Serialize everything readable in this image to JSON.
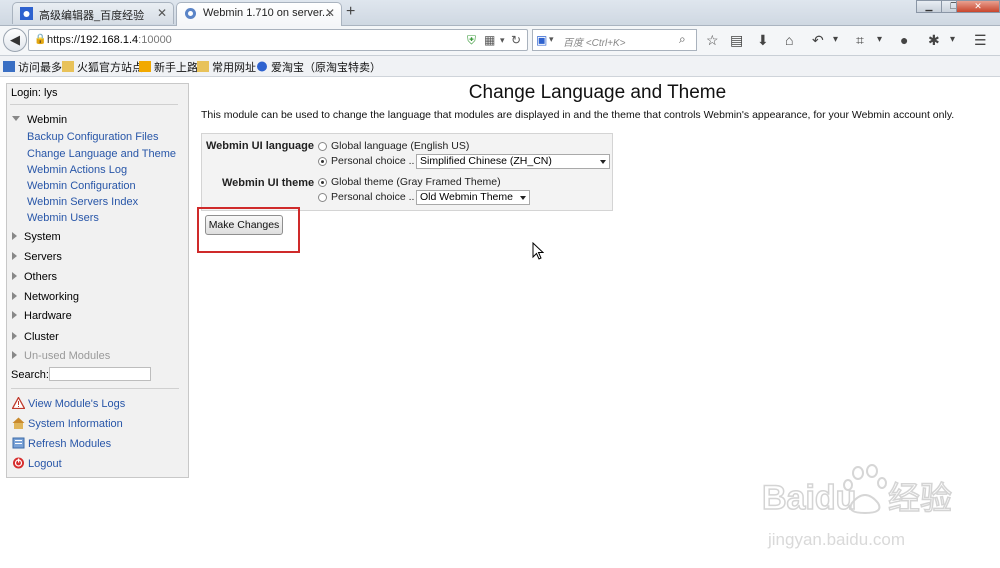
{
  "browser": {
    "tabs": [
      {
        "label": "高级编辑器_百度经验",
        "active": false
      },
      {
        "label": "Webmin 1.710 on server...",
        "active": true
      }
    ],
    "url": {
      "scheme": "https://",
      "host": "192.168.1.4",
      "port": ":10000"
    },
    "search_placeholder": "百度 <Ctrl+K>",
    "bookmarks": [
      "访问最多",
      "火狐官方站点",
      "新手上路",
      "常用网址",
      "爱淘宝（原淘宝特卖）"
    ]
  },
  "sidebar": {
    "login": "Login: lys",
    "webmin_label": "Webmin",
    "webmin_items": [
      "Backup Configuration Files",
      "Change Language and Theme",
      "Webmin Actions Log",
      "Webmin Configuration",
      "Webmin Servers Index",
      "Webmin Users"
    ],
    "categories": [
      "System",
      "Servers",
      "Others",
      "Networking",
      "Hardware",
      "Cluster",
      "Un-used Modules"
    ],
    "search_label": "Search:",
    "actions": [
      "View Module's Logs",
      "System Information",
      "Refresh Modules",
      "Logout"
    ]
  },
  "main": {
    "title": "Change Language and Theme",
    "description": "This module can be used to change the language that modules are displayed in and the theme that controls Webmin's appearance, for your Webmin account only.",
    "language": {
      "label": "Webmin UI language",
      "option_global": "Global language (English US)",
      "option_personal": "Personal choice ..",
      "selected": "personal",
      "select_value": "Simplified Chinese (ZH_CN)"
    },
    "theme": {
      "label": "Webmin UI theme",
      "option_global": "Global theme (Gray Framed Theme)",
      "option_personal": "Personal choice ..",
      "selected": "global",
      "select_value": "Old Webmin Theme"
    },
    "submit_label": "Make Changes"
  },
  "watermark": {
    "brand": "Baidu",
    "cn": "经验",
    "url": "jingyan.baidu.com"
  }
}
